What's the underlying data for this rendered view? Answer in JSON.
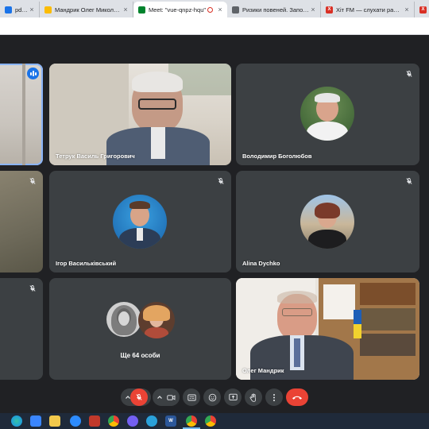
{
  "browser": {
    "tabs": [
      {
        "title": "pdf - Goog",
        "favicon": "document-icon",
        "favicon_color": "#1a73e8",
        "active": false
      },
      {
        "title": "Мандрик Олег Миколайови",
        "favicon": "document-icon",
        "favicon_color": "#fbbc04",
        "active": false
      },
      {
        "title": "Meet: \"vue-qnpz-hqu\"",
        "favicon": "meet-icon",
        "favicon_color": "#00832d",
        "active": true,
        "recording": true
      },
      {
        "title": "Ризики повеней. Запобігання",
        "favicon": "globe-icon",
        "favicon_color": "#5f6368",
        "active": false
      },
      {
        "title": "Хіт FM — слухати радіо онлай",
        "favicon": "radio-icon",
        "favicon_color": "#d93025",
        "active": false
      },
      {
        "title": "Х",
        "favicon": "radio-icon",
        "favicon_color": "#d93025",
        "active": false
      }
    ]
  },
  "meet": {
    "participants": [
      {
        "name": "",
        "muted": false,
        "speaking": true
      },
      {
        "name": "Тетрук Василь Григорович",
        "muted": false,
        "speaking": false
      },
      {
        "name": "Володимир Боголюбов",
        "muted": true,
        "speaking": false
      },
      {
        "name": "",
        "muted": true,
        "speaking": false
      },
      {
        "name": "Ігор Васильківський",
        "muted": true,
        "speaking": false
      },
      {
        "name": "Alina Dychko",
        "muted": true,
        "speaking": false
      },
      {
        "name": "",
        "muted": true,
        "speaking": false
      },
      {
        "name": "Олег Мандрик",
        "muted": true,
        "speaking": false
      }
    ],
    "others_label": "Ще 64 особи"
  },
  "controls": [
    {
      "icon": "chevron-up-icon"
    },
    {
      "icon": "mic-off-icon",
      "state": "off"
    },
    {
      "icon": "chevron-up-icon"
    },
    {
      "icon": "camera-icon"
    },
    {
      "icon": "captions-icon"
    },
    {
      "icon": "emoji-icon"
    },
    {
      "icon": "present-icon"
    },
    {
      "icon": "raise-hand-icon"
    },
    {
      "icon": "more-vert-icon"
    },
    {
      "icon": "end-call-icon"
    }
  ],
  "taskbar": {
    "apps": [
      {
        "icon": "edge-icon",
        "color": "#1f9ddb"
      },
      {
        "icon": "store-icon",
        "color": "#3a86ff"
      },
      {
        "icon": "folder-icon",
        "color": "#f2c94c"
      },
      {
        "icon": "zoom-icon",
        "color": "#2d8cff"
      },
      {
        "icon": "app-icon",
        "color": "#c0392b"
      },
      {
        "icon": "chrome-icon",
        "color": "#4285f4"
      },
      {
        "icon": "viber-icon",
        "color": "#7360f2"
      },
      {
        "icon": "telegram-icon",
        "color": "#2aa1da"
      },
      {
        "icon": "word-icon",
        "color": "#2b579a"
      },
      {
        "icon": "chrome-icon",
        "color": "#4285f4"
      },
      {
        "icon": "chrome-icon",
        "color": "#34a853"
      }
    ]
  }
}
